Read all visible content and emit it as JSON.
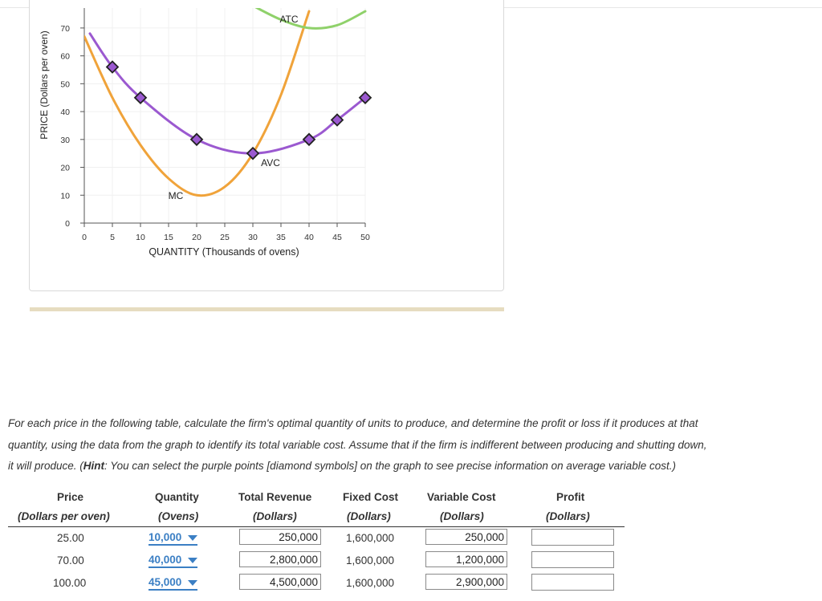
{
  "graph": {
    "y_axis_label": "PRICE (Dollars per oven)",
    "x_axis_label": "QUANTITY (Thousands of ovens)",
    "y_ticks": [
      "0",
      "10",
      "20",
      "30",
      "40",
      "50",
      "60",
      "70"
    ],
    "x_ticks": [
      "0",
      "5",
      "10",
      "15",
      "20",
      "25",
      "30",
      "35",
      "40",
      "45",
      "50"
    ],
    "curve_labels": {
      "atc": "ATC",
      "avc": "AVC",
      "mc": "MC"
    },
    "colors": {
      "atc": "#8fd16a",
      "avc": "#9b59d0",
      "mc": "#f0a33a",
      "diamond_fill": "#9b59d0",
      "diamond_stroke": "#222222"
    }
  },
  "chart_data": {
    "type": "line",
    "xlabel": "QUANTITY (Thousands of ovens)",
    "ylabel": "PRICE (Dollars per oven)",
    "xlim": [
      0,
      50
    ],
    "ylim": [
      0,
      70
    ],
    "grid": true,
    "series": [
      {
        "name": "AVC",
        "x": [
          1,
          5,
          10,
          20,
          30,
          40,
          45,
          50
        ],
        "y": [
          68,
          56,
          45,
          30,
          25,
          30,
          37,
          45
        ],
        "markers": [
          5,
          10,
          20,
          30,
          40,
          45,
          50
        ]
      },
      {
        "name": "MC",
        "x": [
          0,
          5,
          10,
          15,
          20,
          25,
          30,
          35,
          40
        ],
        "y": [
          67,
          45,
          28,
          16,
          10,
          13,
          25,
          46,
          76
        ]
      },
      {
        "name": "ATC",
        "x": [
          30,
          35,
          40,
          45,
          50
        ],
        "y": [
          78,
          73,
          70,
          71,
          76
        ]
      }
    ]
  },
  "instructions": {
    "line1": "For each price in the following table, calculate the firm's optimal quantity of units to produce, and determine the profit or loss if it produces at that",
    "line2": "quantity, using the data from the graph to identify its total variable cost. Assume that if the firm is indifferent between producing and shutting down,",
    "line3_pre": "it will produce. (",
    "hint_label": "Hint",
    "line3_post": ": You can select the purple points [diamond symbols] on the graph to see precise information on average variable cost.)"
  },
  "table": {
    "headers": [
      {
        "title": "Price",
        "unit": "(Dollars per oven)"
      },
      {
        "title": "Quantity",
        "unit": "(Ovens)"
      },
      {
        "title": "Total Revenue",
        "unit": "(Dollars)"
      },
      {
        "title": "Fixed Cost",
        "unit": "(Dollars)"
      },
      {
        "title": "Variable Cost",
        "unit": "(Dollars)"
      },
      {
        "title": "Profit",
        "unit": "(Dollars)"
      }
    ],
    "rows": [
      {
        "price": "25.00",
        "quantity": "10,000",
        "total_revenue": "250,000",
        "fixed_cost": "1,600,000",
        "variable_cost": "250,000",
        "profit": ""
      },
      {
        "price": "70.00",
        "quantity": "40,000",
        "total_revenue": "2,800,000",
        "fixed_cost": "1,600,000",
        "variable_cost": "1,200,000",
        "profit": ""
      },
      {
        "price": "100.00",
        "quantity": "45,000",
        "total_revenue": "4,500,000",
        "fixed_cost": "1,600,000",
        "variable_cost": "2,900,000",
        "profit": ""
      }
    ]
  }
}
